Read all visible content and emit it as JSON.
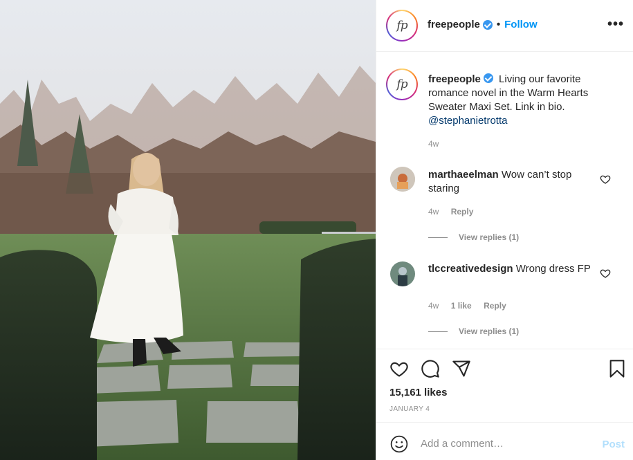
{
  "post": {
    "username": "freepeople",
    "follow_label": "Follow",
    "dot": "•",
    "more_label": "•••",
    "avatar_text": "fp"
  },
  "caption": {
    "username": "freepeople",
    "text": "Living our favorite romance novel in the Warm Hearts Sweater Maxi Set. Link in bio.",
    "mention": "@stephanietrotta",
    "time": "4w"
  },
  "comments": [
    {
      "username": "marthaeelman",
      "text": "Wow can’t stop staring",
      "time": "4w",
      "likes": "",
      "reply_label": "Reply",
      "view_replies": "View replies (1)"
    },
    {
      "username": "tlccreativedesign",
      "text": "Wrong dress FP",
      "time": "4w",
      "likes": "1 like",
      "reply_label": "Reply",
      "view_replies": "View replies (1)"
    }
  ],
  "actions": {
    "likes": "15,161 likes",
    "date": "JANUARY 4",
    "icons": [
      "heart-icon",
      "comment-icon",
      "share-icon",
      "bookmark-icon"
    ]
  },
  "add_comment": {
    "placeholder": "Add a comment…",
    "post_label": "Post"
  },
  "colors": {
    "link": "#0095f6",
    "verified": "#3897f0",
    "muted": "#8e8e8e",
    "post_disabled": "#b2dffc"
  }
}
